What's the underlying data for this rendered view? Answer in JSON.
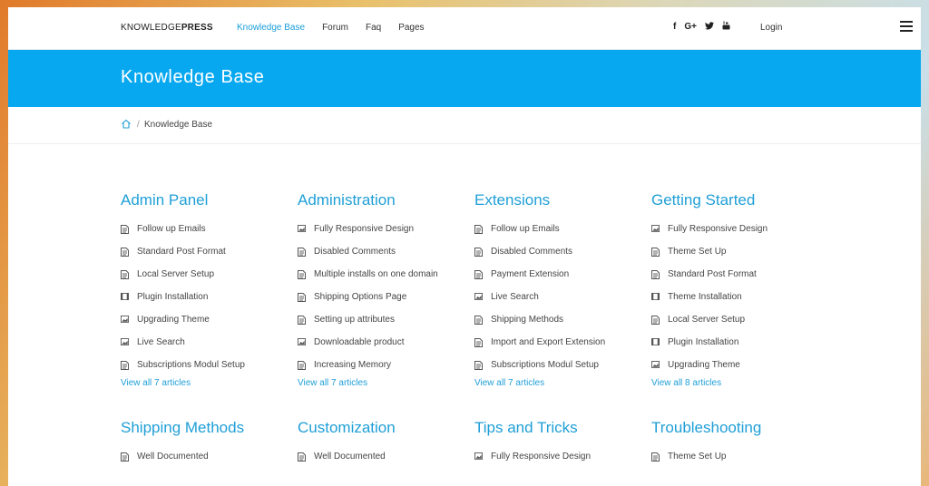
{
  "header": {
    "logo_part1": "KNOWLEDGE",
    "logo_part2": "PRESS",
    "nav": [
      "Knowledge Base",
      "Forum",
      "Faq",
      "Pages"
    ],
    "social": [
      "f",
      "G+",
      "t",
      "yt"
    ],
    "login": "Login"
  },
  "banner": {
    "title": "Knowledge Base"
  },
  "breadcrumb": {
    "separator": "/",
    "current": "Knowledge Base"
  },
  "categories": [
    {
      "title": "Admin Panel",
      "items": [
        {
          "label": "Follow up Emails",
          "icon": "document-icon"
        },
        {
          "label": "Standard Post Format",
          "icon": "document-icon"
        },
        {
          "label": "Local Server Setup",
          "icon": "document-icon"
        },
        {
          "label": "Plugin Installation",
          "icon": "video-icon"
        },
        {
          "label": "Upgrading Theme",
          "icon": "image-icon"
        },
        {
          "label": "Live Search",
          "icon": "image-icon"
        },
        {
          "label": "Subscriptions Modul Setup",
          "icon": "document-icon"
        }
      ],
      "view_all": "View all 7 articles"
    },
    {
      "title": "Administration",
      "items": [
        {
          "label": "Fully Responsive Design",
          "icon": "image-icon"
        },
        {
          "label": "Disabled Comments",
          "icon": "document-icon"
        },
        {
          "label": "Multiple installs on one domain",
          "icon": "document-icon"
        },
        {
          "label": "Shipping Options Page",
          "icon": "document-icon"
        },
        {
          "label": "Setting up attributes",
          "icon": "document-icon"
        },
        {
          "label": "Downloadable product",
          "icon": "image-icon"
        },
        {
          "label": "Increasing Memory",
          "icon": "document-icon"
        }
      ],
      "view_all": "View all 7 articles"
    },
    {
      "title": "Extensions",
      "items": [
        {
          "label": "Follow up Emails",
          "icon": "document-icon"
        },
        {
          "label": "Disabled Comments",
          "icon": "document-icon"
        },
        {
          "label": "Payment Extension",
          "icon": "document-icon"
        },
        {
          "label": "Live Search",
          "icon": "image-icon"
        },
        {
          "label": "Shipping Methods",
          "icon": "document-icon"
        },
        {
          "label": "Import and Export Extension",
          "icon": "document-icon"
        },
        {
          "label": "Subscriptions Modul Setup",
          "icon": "document-icon"
        }
      ],
      "view_all": "View all 7 articles"
    },
    {
      "title": "Getting Started",
      "items": [
        {
          "label": "Fully Responsive Design",
          "icon": "image-icon"
        },
        {
          "label": "Theme Set Up",
          "icon": "document-icon"
        },
        {
          "label": "Standard Post Format",
          "icon": "document-icon"
        },
        {
          "label": "Theme Installation",
          "icon": "video-icon"
        },
        {
          "label": "Local Server Setup",
          "icon": "document-icon"
        },
        {
          "label": "Plugin Installation",
          "icon": "video-icon"
        },
        {
          "label": "Upgrading Theme",
          "icon": "image-icon"
        }
      ],
      "view_all": "View all 8 articles"
    },
    {
      "title": "Shipping Methods",
      "items": [
        {
          "label": "Well Documented",
          "icon": "document-icon"
        }
      ],
      "view_all": ""
    },
    {
      "title": "Customization",
      "items": [
        {
          "label": "Well Documented",
          "icon": "document-icon"
        }
      ],
      "view_all": ""
    },
    {
      "title": "Tips and Tricks",
      "items": [
        {
          "label": "Fully Responsive Design",
          "icon": "image-icon"
        }
      ],
      "view_all": ""
    },
    {
      "title": "Troubleshooting",
      "items": [
        {
          "label": "Theme Set Up",
          "icon": "document-icon"
        }
      ],
      "view_all": ""
    }
  ],
  "colors": {
    "accent": "#1f9fd7",
    "banner": "#07a8f0",
    "text": "#444444"
  }
}
